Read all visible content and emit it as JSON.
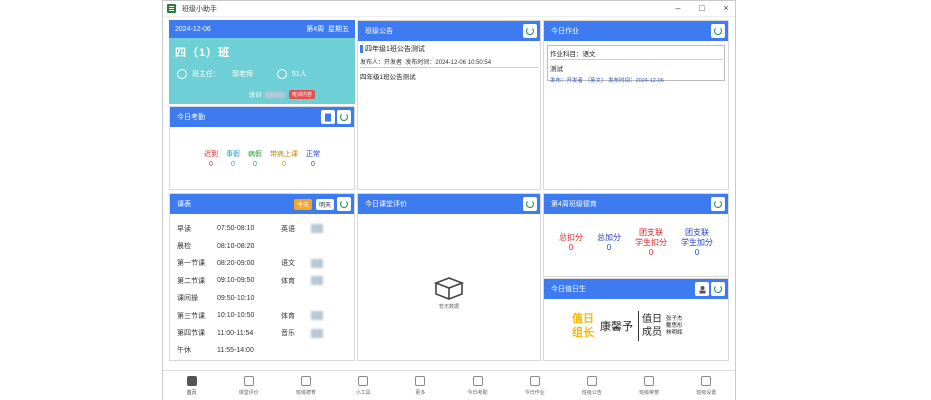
{
  "window": {
    "title": "班级小助手"
  },
  "class_card": {
    "date": "2024-12-06",
    "week": "第4周",
    "weekday": "星期五",
    "class_name": "四（1）班",
    "teacher_label": "班主任：",
    "teacher_name": "郭老师",
    "student_count": "51人",
    "motto_label": "班训",
    "motto_tag": "班训内容"
  },
  "attendance": {
    "title": "今日考勤",
    "items": [
      {
        "label": "迟到",
        "value": "0",
        "color": "#e02020"
      },
      {
        "label": "事假",
        "value": "0",
        "color": "#1aa3d8"
      },
      {
        "label": "病假",
        "value": "0",
        "color": "#2f9a3a"
      },
      {
        "label": "带病上课",
        "value": "0",
        "color": "#c58a00"
      },
      {
        "label": "正常",
        "value": "0",
        "color": "#1f40c8"
      }
    ]
  },
  "schedule": {
    "title": "课表",
    "today_label": "今天",
    "tomorrow_label": "明天",
    "rows": [
      {
        "period": "早读",
        "time": "07:50-08:10",
        "subject": "英语"
      },
      {
        "period": "晨检",
        "time": "08:10-08:20",
        "subject": ""
      },
      {
        "period": "第一节课",
        "time": "08:20-09:00",
        "subject": "语文"
      },
      {
        "period": "第二节课",
        "time": "09:10-09:50",
        "subject": "体育"
      },
      {
        "period": "课间操",
        "time": "09:50-10:10",
        "subject": ""
      },
      {
        "period": "第三节课",
        "time": "10:10-10:50",
        "subject": "体育"
      },
      {
        "period": "第四节课",
        "time": "11:00-11:54",
        "subject": "音乐"
      },
      {
        "period": "午休",
        "time": "11:55-14:00",
        "subject": ""
      }
    ]
  },
  "notice": {
    "title": "班级公告",
    "item_title": "四年级1班公告测试",
    "publisher_label": "发布人：",
    "publisher": "开发者",
    "time_label": "发布时间：",
    "time": "2024-12-06 10:50:54",
    "content": "四年级1班公告测试"
  },
  "homework": {
    "title": "今日作业",
    "subject_label": "作业科目：",
    "subject": "语文",
    "content": "测试",
    "publisher_label": "发布：",
    "publisher": "开发者",
    "role": "（英文）",
    "time_label": "发布时间：",
    "time": "2024-12-06"
  },
  "evaluation": {
    "title": "今日课堂评价",
    "empty_text": "暂无数据"
  },
  "points": {
    "title": "第4周班级德育",
    "items": [
      {
        "label": "总扣分",
        "value": "0",
        "color": "#e02020"
      },
      {
        "label": "总加分",
        "value": "0",
        "color": "#1f40c8"
      },
      {
        "label": "团支联\n学生扣分",
        "value": "0",
        "color": "#e02020"
      },
      {
        "label": "团支联\n学生加分",
        "value": "0",
        "color": "#1f40c8"
      }
    ]
  },
  "duty": {
    "title": "今日值日生",
    "leader_label_1": "值日",
    "leader_label_2": "组长",
    "leader_name": "康馨予",
    "member_label_1": "值日",
    "member_label_2": "成员",
    "members": [
      "张子杰",
      "戴思彤",
      "林明辉"
    ]
  },
  "bottom_nav": [
    {
      "label": "首页",
      "icon": "home-icon"
    },
    {
      "label": "课堂评价",
      "icon": "evaluate-icon"
    },
    {
      "label": "班级德育",
      "icon": "book-icon"
    },
    {
      "label": "小工具",
      "icon": "toolbox-icon"
    },
    {
      "label": "更多",
      "icon": "menu-icon"
    },
    {
      "label": "今日考勤",
      "icon": "calendar-icon"
    },
    {
      "label": "今日作业",
      "icon": "pen-icon"
    },
    {
      "label": "班级公告",
      "icon": "notice-icon"
    },
    {
      "label": "班级荣誉",
      "icon": "tree-icon"
    },
    {
      "label": "班级设置",
      "icon": "settings-icon"
    }
  ]
}
